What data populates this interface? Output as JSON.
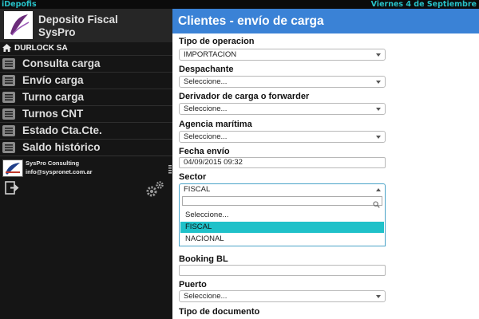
{
  "topbar": {
    "app_name": "iDepofis",
    "date": "Viernes 4 de Septiembre"
  },
  "brand": {
    "title_line1": "Deposito Fiscal",
    "title_line2": "SysPro",
    "logo_label": "SysPro"
  },
  "company": {
    "name": "DURLOCK SA"
  },
  "menu": {
    "items": [
      {
        "label": "Consulta carga",
        "icon": "list-icon"
      },
      {
        "label": "Envío carga",
        "icon": "list-icon"
      },
      {
        "label": "Turno carga",
        "icon": "list-icon"
      },
      {
        "label": "Turnos CNT",
        "icon": "list-icon"
      },
      {
        "label": "Estado Cta.Cte.",
        "icon": "list-icon"
      },
      {
        "label": "Saldo histórico",
        "icon": "list-icon"
      }
    ]
  },
  "consultant": {
    "name": "SysPro Consulting",
    "email": "info@syspronet.com.ar",
    "logo_label": "SysPro"
  },
  "icons": {
    "logout": "logout-icon",
    "settings": "gears-icon",
    "home": "home-icon",
    "search": "search-icon"
  },
  "main": {
    "title": "Clientes - envío de carga",
    "fields": {
      "tipo_operacion": {
        "label": "Tipo de operacion",
        "value": "IMPORTACION"
      },
      "despachante": {
        "label": "Despachante",
        "value": "Seleccione..."
      },
      "derivador": {
        "label": "Derivador de carga o forwarder",
        "value": "Seleccione..."
      },
      "agencia": {
        "label": "Agencia marítima",
        "value": "Seleccione..."
      },
      "fecha": {
        "label": "Fecha envío",
        "value": "04/09/2015 09:32"
      },
      "sector": {
        "label": "Sector",
        "value": "FISCAL",
        "search_value": "",
        "options": [
          "Seleccione...",
          "FISCAL",
          "NACIONAL"
        ],
        "highlighted": "FISCAL"
      },
      "booking": {
        "label": "Booking BL",
        "value": ""
      },
      "puerto": {
        "label": "Puerto",
        "value": "Seleccione..."
      },
      "tipo_documento": {
        "label": "Tipo de documento"
      }
    }
  },
  "colors": {
    "accent": "#3a82d6",
    "cyan": "#27c1c8",
    "highlight": "#1fc1c9",
    "sidebar_bg": "#151515"
  }
}
